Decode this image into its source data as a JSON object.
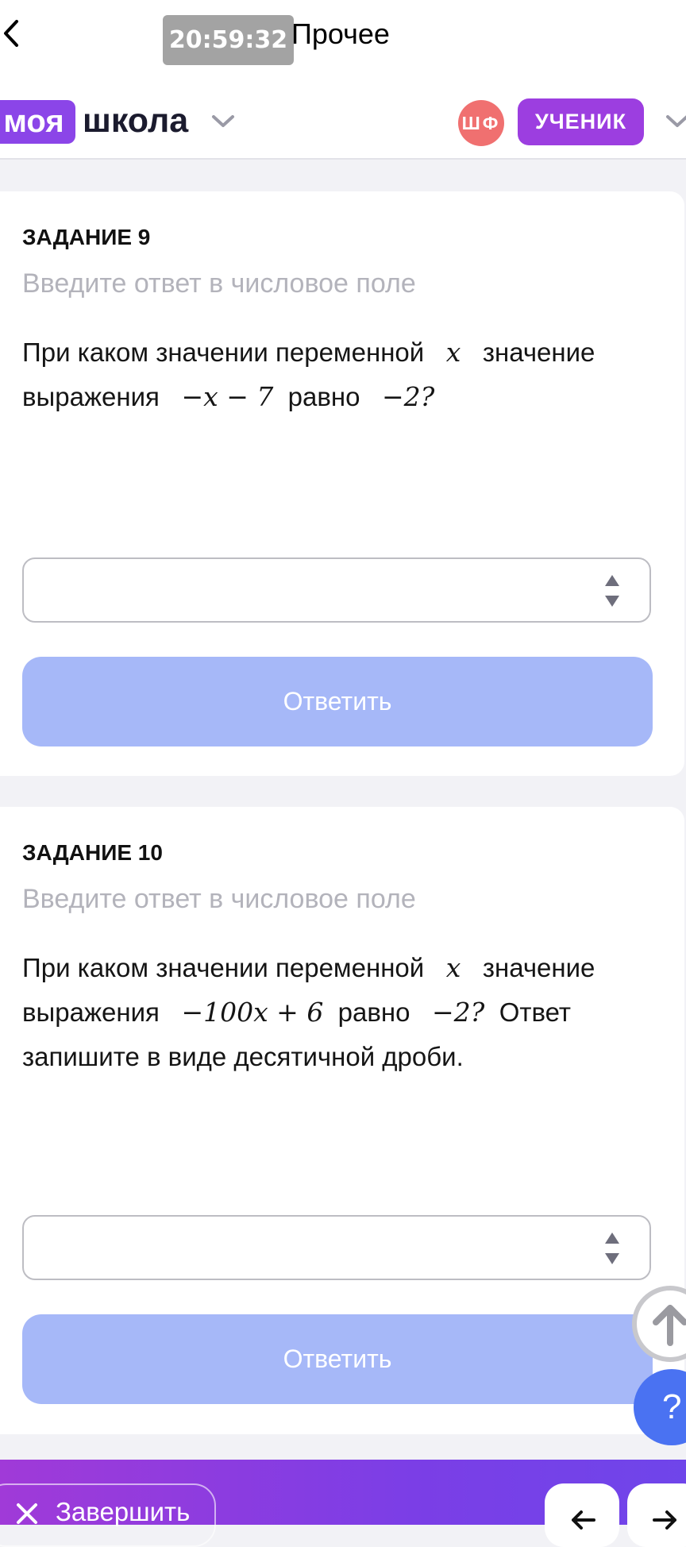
{
  "status": {
    "time": "20:59:32",
    "screen_title": "Прочее"
  },
  "header": {
    "logo_box": "моя",
    "logo_text": "школа",
    "avatar_initials": "ШФ",
    "role": "УЧЕНИК"
  },
  "tasks": [
    {
      "title": "ЗАДАНИЕ 9",
      "hint": "Введите ответ в числовое поле",
      "text_parts": {
        "p1": "При каком значении переменной",
        "m1": "x",
        "p2": "значение выражения",
        "m2": "−x − 7",
        "p3": "равно",
        "m3": "−2?"
      },
      "input_value": "",
      "submit_label": "Ответить"
    },
    {
      "title": "ЗАДАНИЕ 10",
      "hint": "Введите ответ в числовое поле",
      "text_parts": {
        "p1": "При каком значении переменной",
        "m1": "x",
        "p2": "значение выражения",
        "m2": "−100x + 6",
        "p3": "равно",
        "m3": "−2?",
        "p4": "Ответ запишите в виде десятичной дроби."
      },
      "input_value": "",
      "submit_label": "Ответить"
    }
  ],
  "floating": {
    "help_label": "?"
  },
  "bottom": {
    "finish_label": "Завершить"
  },
  "colors": {
    "brand_purple": "#8b45e8",
    "button_disabled": "#a6b8f8",
    "help_blue": "#4a72f2",
    "avatar_red": "#f07070"
  }
}
